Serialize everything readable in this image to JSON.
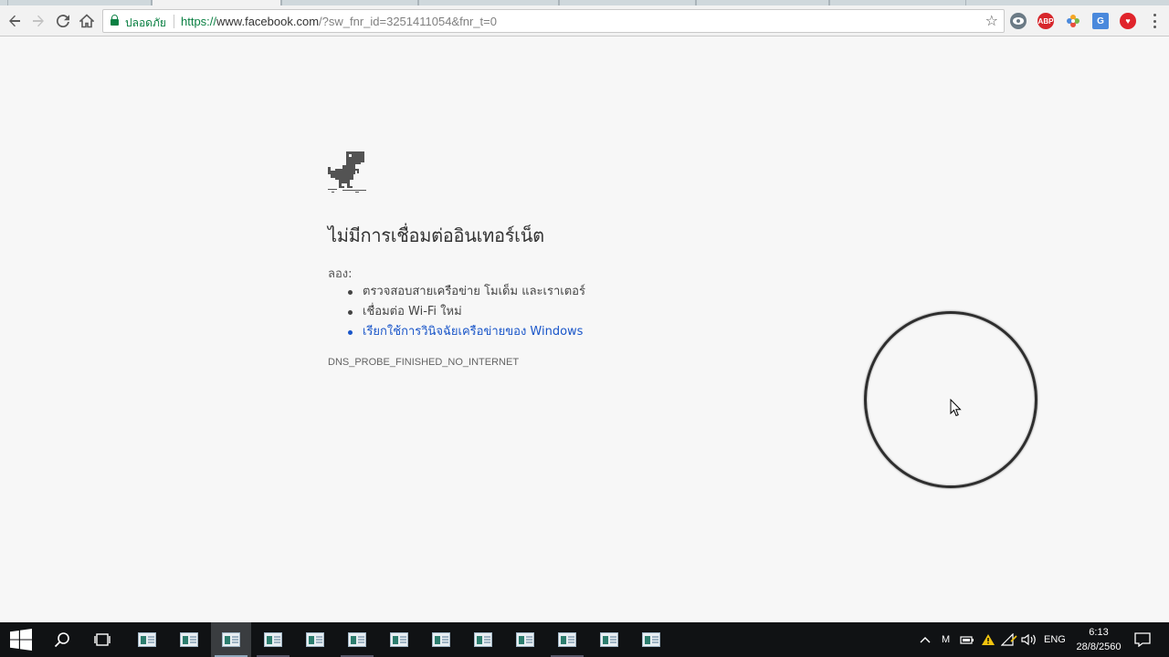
{
  "browser": {
    "omnibox": {
      "secure_label": "ปลอดภัย",
      "url_scheme": "https://",
      "url_host": "www.facebook.com",
      "url_rest": "/?sw_fnr_id=3251411054&fnr_t=0"
    },
    "extensions": [
      {
        "name": "extension-eye-icon",
        "color": "#6b7a85"
      },
      {
        "name": "adblock-plus-icon",
        "label": "ABP",
        "color": "#d7262b"
      },
      {
        "name": "extension-flower-icon",
        "color": "#7ab648"
      },
      {
        "name": "google-translate-icon",
        "color": "#4a89dc"
      },
      {
        "name": "extension-heart-icon",
        "color": "#e0242b"
      }
    ]
  },
  "error_page": {
    "title": "ไม่มีการเชื่อมต่ออินเทอร์เน็ต",
    "try_label": "ลอง:",
    "suggestions": [
      "ตรวจสอบสายเครือข่าย โมเด็ม และเราเตอร์",
      "เชื่อมต่อ Wi-Fi ใหม่",
      "เรียกใช้การวินิจฉัยเครือข่ายของ Windows"
    ],
    "error_code": "DNS_PROBE_FINISHED_NO_INTERNET"
  },
  "taskbar": {
    "language": "ENG",
    "time": "6:13",
    "date": "28/8/2560"
  }
}
